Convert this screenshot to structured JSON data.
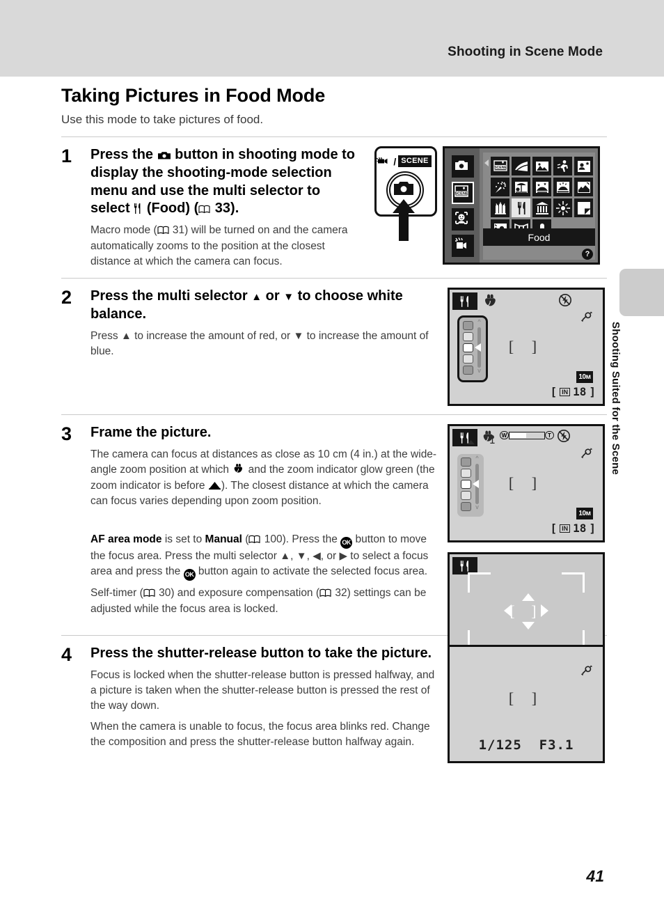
{
  "header": {
    "title": "Shooting in Scene Mode"
  },
  "side_tab": {
    "label": "Shooting Suited for the Scene"
  },
  "footer": {
    "page_number": "41"
  },
  "doc": {
    "title": "Taking Pictures in Food Mode",
    "intro": "Use this mode to take pictures of food."
  },
  "steps": [
    {
      "number": "1",
      "lead_a": "Press the ",
      "lead_b": " button in shooting mode to display the shooting-mode selection menu and use the multi selector to select ",
      "lead_c": " (Food) (",
      "lead_d": " 33).",
      "sub": "Macro mode (",
      "sub_ref": " 31) will be turned on and the camera automatically zooms to the position at the closest distance at which the camera can focus."
    },
    {
      "number": "2",
      "lead_a": "Press the multi selector ",
      "lead_b": " or ",
      "lead_c": " to choose white balance.",
      "sub_a": "Press ",
      "sub_b": " to increase the amount of red, or ",
      "sub_c": " to increase the amount of blue."
    },
    {
      "number": "3",
      "lead": "Frame the picture.",
      "sub_a": "The camera can focus at distances as close as 10 cm (4 in.) at the wide-angle zoom position at which ",
      "sub_b": " and the zoom indicator glow green (the zoom indicator is before ",
      "sub_c": "). The closest distance at which the camera can focus varies depending upon zoom position.",
      "note_a": "AF area mode",
      "note_b": " is set to ",
      "note_c": "Manual",
      "note_d": " (",
      "note_e": " 100). Press the ",
      "note_f": " button to move the focus area. Press the multi selector ",
      "note_g": ", ",
      "note_h": ", ",
      "note_i": ", or ",
      "note_j": " to select a focus area and press the ",
      "note_k": " button again to activate the selected focus area.",
      "note2_a": "Self-timer (",
      "note2_b": " 30) and exposure compensation (",
      "note2_c": " 32) settings can be adjusted while the focus area is locked."
    },
    {
      "number": "4",
      "lead": "Press the shutter-release button to take the picture.",
      "sub1": "Focus is locked when the shutter-release button is pressed halfway, and a picture is taken when the shutter-release button is pressed the rest of the way down.",
      "sub2": "When the camera is unable to focus, the focus area blinks red. Change the composition and press the shutter-release button halfway again."
    }
  ],
  "button_illustration": {
    "movie_icon": "movie-camera-icon",
    "separator": "/",
    "scene_label": "SCENE",
    "camera_icon": "camera-mode-icon",
    "arrow": "press-up-arrow"
  },
  "scene_menu": {
    "mode_icons": [
      "auto-mode-icon",
      "scene-mode-icon",
      "smart-portrait-icon",
      "movie-mode-icon"
    ],
    "selected_mode_index": 1,
    "scene_icons": [
      "scene-auto-selector-icon",
      "portrait-icon",
      "landscape-icon",
      "sports-icon",
      "night-portrait-icon",
      "party-indoor-icon",
      "beach-icon",
      "snow-icon",
      "sunset-icon",
      "dusk-dawn-icon",
      "night-landscape-icon",
      "close-up-food-icon",
      "museum-icon",
      "fireworks-icon",
      "copy-icon",
      "backlight-icon",
      "panorama-assist-icon",
      "pet-portrait-icon"
    ],
    "highlighted_icon_index": 11,
    "caption": "Food",
    "help_badge": "?"
  },
  "lcd_step2": {
    "mode_indicator": "food-mode-icon",
    "macro_indicator": "macro-flower-icon",
    "flash_indicator": "flash-off-icon",
    "shake_indicator": "vibration-reduction-icon",
    "white_balance_levels": 5,
    "white_balance_selected": 3,
    "focus_brackets": "[  ]",
    "image_size": "10м",
    "memory_label": "IN",
    "shots_remaining": "18"
  },
  "lcd_step3_zoom": {
    "mode_indicator": "food-mode-icon",
    "macro_indicator": "macro-flower-icon",
    "zoom_wide_label": "W",
    "zoom_tele_label": "T",
    "flash_indicator": "flash-off-icon",
    "shake_indicator": "vibration-reduction-icon",
    "white_balance_levels": 5,
    "white_balance_selected": 3,
    "focus_brackets": "[  ]",
    "image_size": "10м",
    "memory_label": "IN",
    "shots_remaining": "18"
  },
  "lcd_step3_focus": {
    "mode_indicator": "food-mode-icon",
    "focus_area_cursor": "four-way-focus-selector",
    "corner_guides": 4
  },
  "lcd_step4": {
    "shake_indicator": "vibration-reduction-icon",
    "focus_brackets": "[  ]",
    "shutter_speed": "1/125",
    "aperture": "F3.1"
  }
}
